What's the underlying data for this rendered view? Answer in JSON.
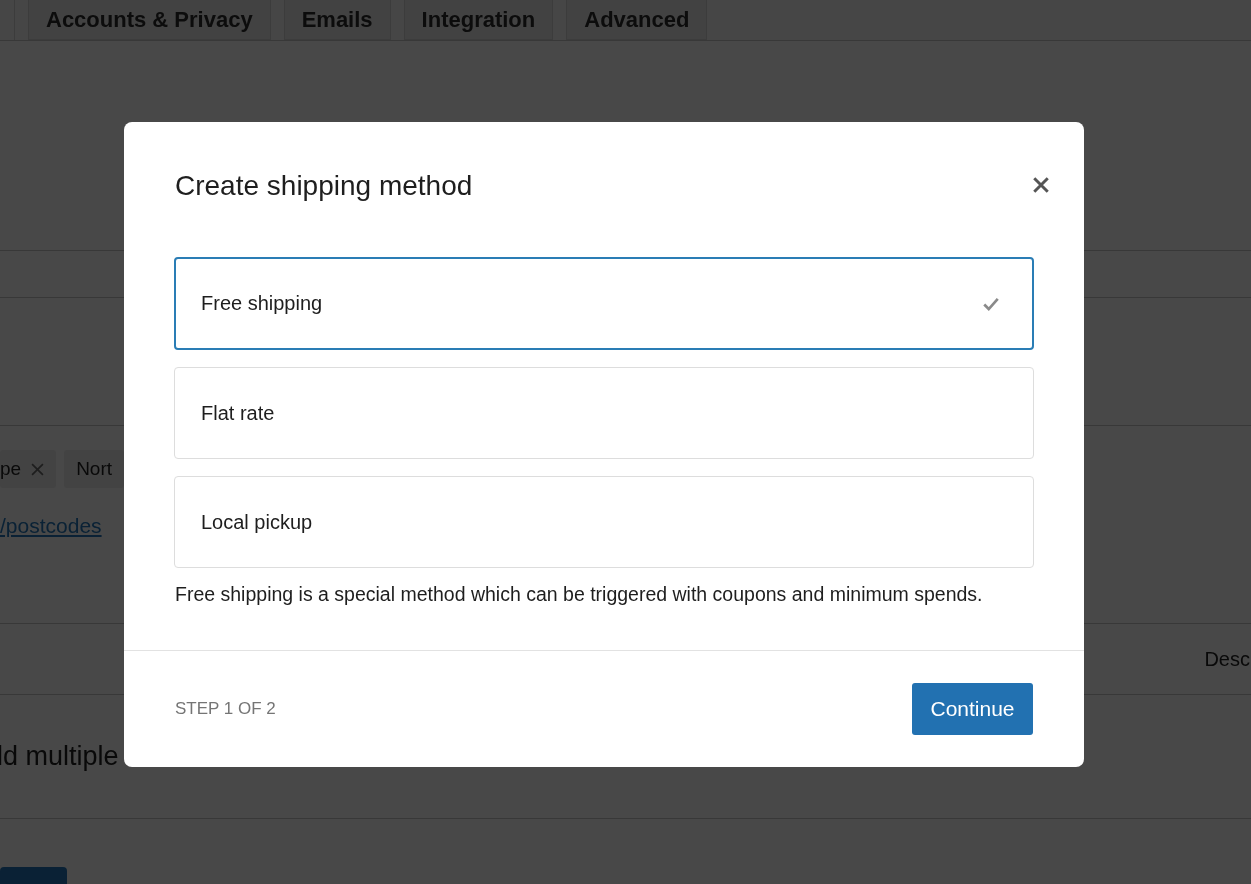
{
  "tabs": [
    {
      "label": "Accounts & Privacy",
      "selected": false
    },
    {
      "label": "Emails",
      "selected": false
    },
    {
      "label": "Integration",
      "selected": false
    },
    {
      "label": "Advanced",
      "selected": false
    }
  ],
  "background": {
    "tags": [
      "pe",
      "Nort"
    ],
    "link": "/postcodes",
    "column_heading": "Desc",
    "note": "ld multiple"
  },
  "modal": {
    "title": "Create shipping method",
    "options": [
      {
        "label": "Free shipping",
        "selected": true
      },
      {
        "label": "Flat rate",
        "selected": false
      },
      {
        "label": "Local pickup",
        "selected": false
      }
    ],
    "description": "Free shipping is a special method which can be triggered with coupons and minimum spends.",
    "step": "STEP 1 OF 2",
    "continue": "Continue"
  }
}
